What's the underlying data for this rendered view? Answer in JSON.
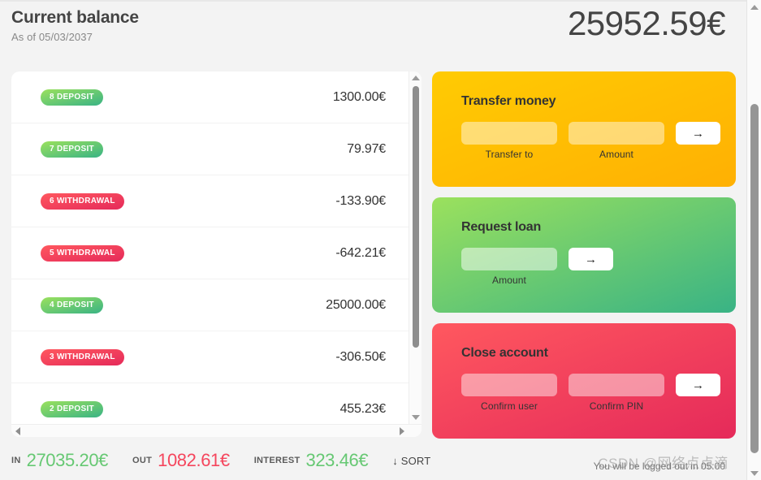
{
  "header": {
    "title": "Current balance",
    "date_prefix": "As of 05/03/2037",
    "balance": "25952.59€"
  },
  "movements": {
    "rows": [
      {
        "index": "8",
        "type": "DEPOSIT",
        "badge": "8 DEPOSIT",
        "value": "1300.00€",
        "kind": "deposit"
      },
      {
        "index": "7",
        "type": "DEPOSIT",
        "badge": "7 DEPOSIT",
        "value": "79.97€",
        "kind": "deposit"
      },
      {
        "index": "6",
        "type": "WITHDRAWAL",
        "badge": "6 WITHDRAWAL",
        "value": "-133.90€",
        "kind": "withdrawal"
      },
      {
        "index": "5",
        "type": "WITHDRAWAL",
        "badge": "5 WITHDRAWAL",
        "value": "-642.21€",
        "kind": "withdrawal"
      },
      {
        "index": "4",
        "type": "DEPOSIT",
        "badge": "4 DEPOSIT",
        "value": "25000.00€",
        "kind": "deposit"
      },
      {
        "index": "3",
        "type": "WITHDRAWAL",
        "badge": "3 WITHDRAWAL",
        "value": "-306.50€",
        "kind": "withdrawal"
      },
      {
        "index": "2",
        "type": "DEPOSIT",
        "badge": "2 DEPOSIT",
        "value": "455.23€",
        "kind": "deposit"
      }
    ]
  },
  "operations": {
    "transfer": {
      "title": "Transfer money",
      "to_value": "",
      "to_label": "Transfer to",
      "amount_value": "",
      "amount_label": "Amount",
      "submit": "→"
    },
    "loan": {
      "title": "Request loan",
      "amount_value": "",
      "amount_label": "Amount",
      "submit": "→"
    },
    "close": {
      "title": "Close account",
      "user_value": "",
      "user_label": "Confirm user",
      "pin_value": "",
      "pin_label": "Confirm PIN",
      "submit": "→"
    }
  },
  "summary": {
    "in_label": "IN",
    "in_value": "27035.20€",
    "out_label": "OUT",
    "out_value": "1082.61€",
    "interest_label": "INTEREST",
    "interest_value": "323.46€",
    "sort_label": "↓ SORT"
  },
  "footer": {
    "logout_timer": "You will be logged out in 05:00",
    "watermark": "CSDN @网络点点滴"
  },
  "colors": {
    "deposit_from": "#9be15d",
    "deposit_to": "#39b385",
    "withdrawal_from": "#ff585f",
    "withdrawal_to": "#e52a5a",
    "transfer_from": "#ffcb03",
    "transfer_to": "#ffb003",
    "in_green": "#66c873",
    "out_red": "#f5465d",
    "page_bg": "#f3f3f3"
  }
}
